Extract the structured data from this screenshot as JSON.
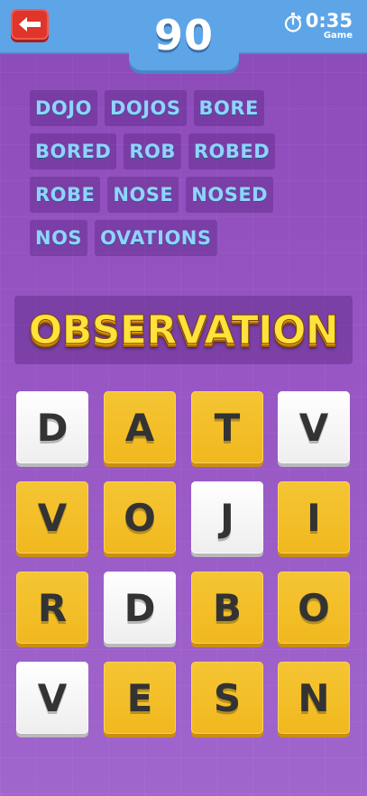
{
  "header": {
    "score": "90",
    "timer_value": "0:35",
    "timer_label": "Game",
    "back_icon": "arrow-left-icon",
    "timer_icon": "stopwatch-icon",
    "back_color": "#e0352b",
    "bar_color": "#5ea5e8"
  },
  "found_words": {
    "rows": [
      [
        "DOJO",
        "DOJOS",
        "BORE"
      ],
      [
        "BORED",
        "ROB",
        "ROBED"
      ],
      [
        "ROBE",
        "NOSE",
        "NOSED"
      ],
      [
        "NOS",
        "OVATIONS"
      ]
    ]
  },
  "target": {
    "word": "OBSERVATION",
    "color": "#ffe23a"
  },
  "board": {
    "tiles": [
      {
        "letter": "D",
        "style": "white"
      },
      {
        "letter": "A",
        "style": "yellow"
      },
      {
        "letter": "T",
        "style": "yellow"
      },
      {
        "letter": "V",
        "style": "white"
      },
      {
        "letter": "V",
        "style": "yellow"
      },
      {
        "letter": "O",
        "style": "yellow"
      },
      {
        "letter": "J",
        "style": "white"
      },
      {
        "letter": "I",
        "style": "yellow"
      },
      {
        "letter": "R",
        "style": "yellow"
      },
      {
        "letter": "D",
        "style": "white"
      },
      {
        "letter": "B",
        "style": "yellow"
      },
      {
        "letter": "O",
        "style": "yellow"
      },
      {
        "letter": "V",
        "style": "white"
      },
      {
        "letter": "E",
        "style": "yellow"
      },
      {
        "letter": "S",
        "style": "yellow"
      },
      {
        "letter": "N",
        "style": "yellow"
      }
    ],
    "yellow_color": "#f5c534",
    "white_color": "#ffffff"
  }
}
